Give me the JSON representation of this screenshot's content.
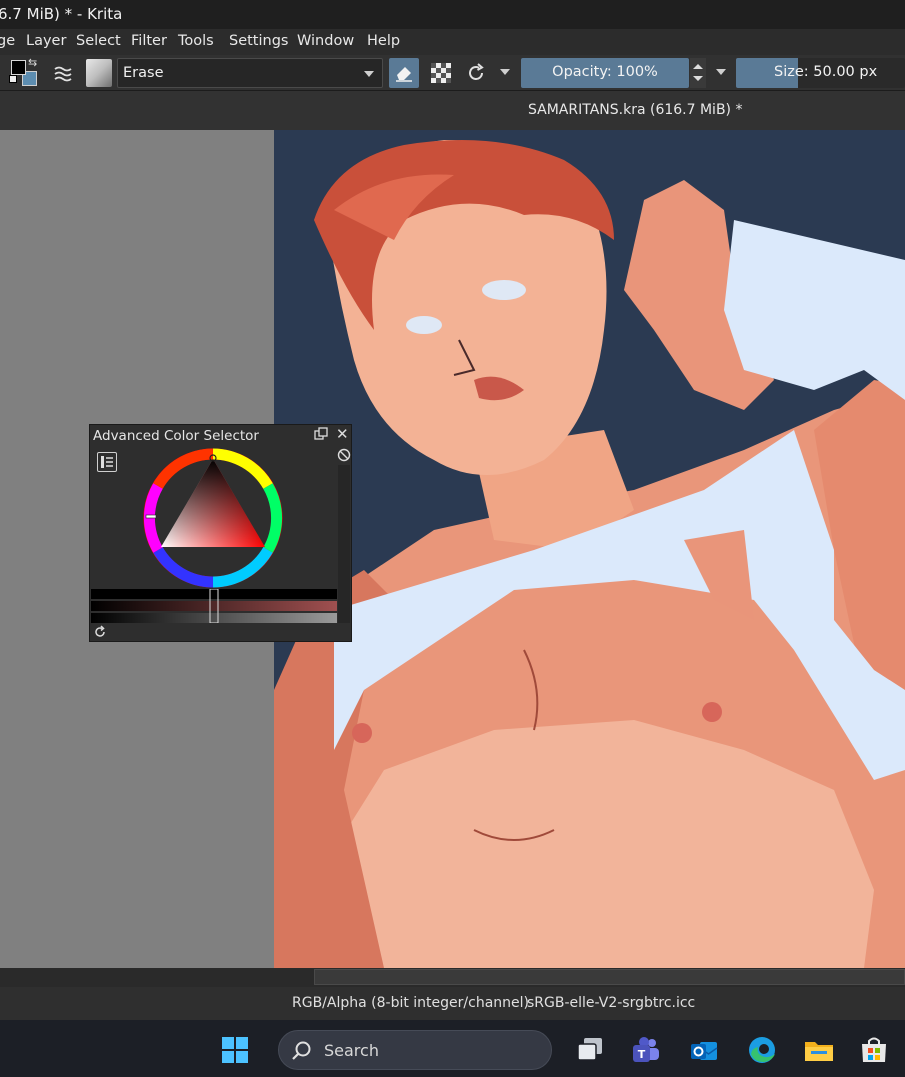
{
  "window": {
    "title": "6.7 MiB) * - Krita"
  },
  "menu": {
    "items": [
      "ge",
      "Layer",
      "Select",
      "Filter",
      "Tools",
      "Settings",
      "Window",
      "Help"
    ]
  },
  "toolbar": {
    "brush_preset": "Erase",
    "opacity_label": "Opacity: 100%",
    "size_label": "Size: 50.00 px",
    "foreground_color": "#000000",
    "background_color": "#5d8db0",
    "icons": [
      "swap-colors-icon",
      "brush-preset-list-icon",
      "eraser-preset-icon",
      "erase-mode-icon",
      "preserve-alpha-icon",
      "reload-preset-icon"
    ]
  },
  "document": {
    "tab_label": "SAMARITANS.kra (616.7 MiB) *"
  },
  "docker": {
    "title": "Advanced Color Selector"
  },
  "status": {
    "color_model": "RGB/Alpha (8-bit integer/channel)",
    "profile": "sRGB-elle-V2-srgbtrc.icc"
  },
  "taskbar": {
    "search_label": "Search",
    "icons": [
      "windows-start-icon",
      "search-icon",
      "task-view-icon",
      "teams-icon",
      "outlook-icon",
      "edge-icon",
      "file-explorer-icon",
      "store-icon"
    ]
  },
  "colors": {
    "accent": "#5a7a96",
    "canvas_bg": "#2b3a52",
    "skin": "#f0a585"
  }
}
